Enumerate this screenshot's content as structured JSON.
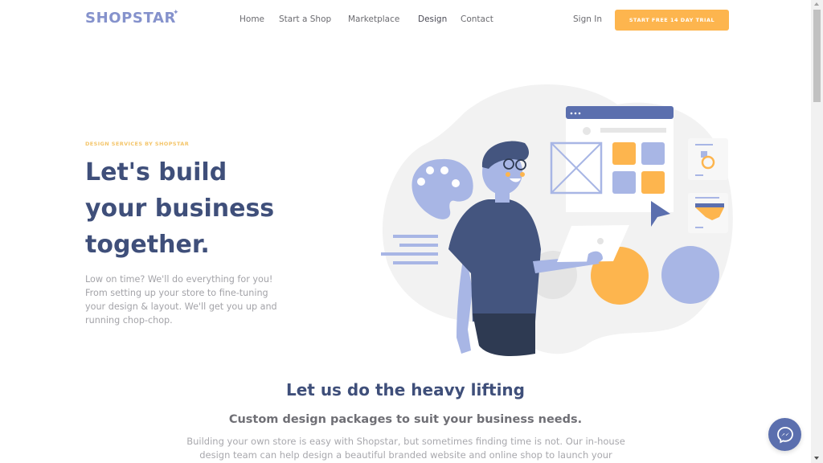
{
  "header": {
    "logo": "SHOPSTAR",
    "logo_mark": "✦",
    "nav": [
      {
        "label": "Home",
        "active": false
      },
      {
        "label": "Start a Shop",
        "active": false
      },
      {
        "label": "Marketplace",
        "active": false
      },
      {
        "label": "Design",
        "active": true
      },
      {
        "label": "Contact",
        "active": false
      }
    ],
    "sign_in": "Sign In",
    "cta": "START FREE 14 DAY TRIAL"
  },
  "hero": {
    "eyebrow": "DESIGN SERVICES BY SHOPSTAR",
    "title_lines": [
      "Let's build",
      "your business",
      "together."
    ],
    "description": "Low on time? We'll do everything for you! From setting up your store to fine-tuning your design & layout. We'll get you up and running chop-chop.",
    "illustration": "designer-with-laptop-illustration"
  },
  "section2": {
    "title": "Let us do the heavy lifting",
    "subtitle": "Custom design packages to suit your business needs.",
    "body": "Building your own store is easy with Shopstar, but sometimes finding time is not. Our in-house design team can help design a beautiful branded website and online shop to launch your"
  },
  "widgets": {
    "messenger": "messenger-chat-icon"
  },
  "colors": {
    "brand": "#8592cc",
    "accent": "#fdb54e",
    "heading": "#3f4f7a",
    "messenger": "#5b6fae"
  }
}
